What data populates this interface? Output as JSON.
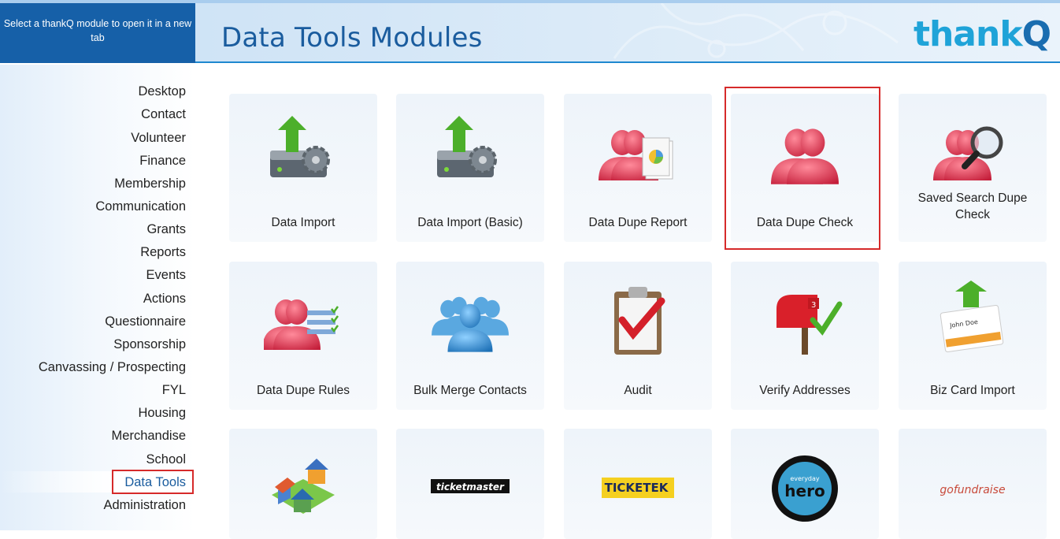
{
  "header": {
    "module_hint": "Select a thankQ module to open it in a new tab",
    "title": "Data Tools Modules",
    "logo_text": "thank",
    "logo_q": "Q"
  },
  "sidebar": {
    "items": [
      {
        "label": "Desktop"
      },
      {
        "label": "Contact"
      },
      {
        "label": "Volunteer"
      },
      {
        "label": "Finance"
      },
      {
        "label": "Membership"
      },
      {
        "label": "Communication"
      },
      {
        "label": "Grants"
      },
      {
        "label": "Reports"
      },
      {
        "label": "Events"
      },
      {
        "label": "Actions"
      },
      {
        "label": "Questionnaire"
      },
      {
        "label": "Sponsorship"
      },
      {
        "label": "Canvassing / Prospecting"
      },
      {
        "label": "FYL"
      },
      {
        "label": "Housing"
      },
      {
        "label": "Merchandise"
      },
      {
        "label": "School"
      },
      {
        "label": "Data Tools"
      },
      {
        "label": "Administration"
      }
    ],
    "active": "Data Tools"
  },
  "tiles": [
    {
      "label": "Data Import",
      "icon": "server-upload-icon"
    },
    {
      "label": "Data Import (Basic)",
      "icon": "server-upload-icon"
    },
    {
      "label": "Data Dupe Report",
      "icon": "people-report-icon"
    },
    {
      "label": "Data Dupe Check",
      "icon": "people-duplicate-icon"
    },
    {
      "label": "Saved Search Dupe Check",
      "icon": "people-search-icon"
    },
    {
      "label": "Data Dupe Rules",
      "icon": "people-rules-icon"
    },
    {
      "label": "Bulk Merge Contacts",
      "icon": "people-group-icon"
    },
    {
      "label": "Audit",
      "icon": "clipboard-check-icon"
    },
    {
      "label": "Verify Addresses",
      "icon": "mailbox-check-icon"
    },
    {
      "label": "Biz Card Import",
      "icon": "business-card-upload-icon"
    },
    {
      "label": "",
      "icon": "houses-map-icon"
    },
    {
      "label": "",
      "icon": "ticketmaster-logo-icon",
      "logo_text": "ticketmaster"
    },
    {
      "label": "",
      "icon": "ticketek-logo-icon",
      "logo_text": "TICKETEK"
    },
    {
      "label": "",
      "icon": "everyday-hero-logo-icon",
      "logo_text": "hero",
      "logo_small": "everyday"
    },
    {
      "label": "",
      "icon": "gofundraise-logo-icon",
      "logo_text": "gofundraise"
    }
  ],
  "highlighted_tile": "Data Dupe Check",
  "colors": {
    "brand_blue": "#1660a8",
    "title_blue": "#1a5c9e",
    "logo_cyan": "#1fa3d8",
    "highlight_red": "#d62a2a",
    "person_red": "#d9344a"
  }
}
